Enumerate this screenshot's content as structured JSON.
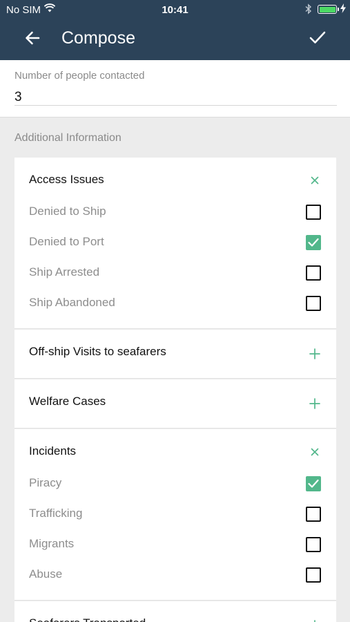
{
  "status_bar": {
    "carrier": "No SIM",
    "time": "10:41",
    "battery_level": 1.0,
    "charging": true
  },
  "app_bar": {
    "title": "Compose"
  },
  "people_contacted": {
    "label": "Number of people contacted",
    "value": "3"
  },
  "additional_info": {
    "heading": "Additional Information",
    "sections": [
      {
        "title": "Access Issues",
        "expanded": true,
        "options": [
          {
            "label": "Denied to Ship",
            "checked": false
          },
          {
            "label": "Denied to Port",
            "checked": true
          },
          {
            "label": "Ship Arrested",
            "checked": false
          },
          {
            "label": "Ship Abandoned",
            "checked": false
          }
        ]
      },
      {
        "title": "Off-ship Visits to seafarers",
        "expanded": false
      },
      {
        "title": "Welfare Cases",
        "expanded": false
      },
      {
        "title": "Incidents",
        "expanded": true,
        "options": [
          {
            "label": "Piracy",
            "checked": true
          },
          {
            "label": "Trafficking",
            "checked": false
          },
          {
            "label": "Migrants",
            "checked": false
          },
          {
            "label": "Abuse",
            "checked": false
          }
        ]
      },
      {
        "title": "Seafarers Transported",
        "expanded": false
      }
    ]
  },
  "colors": {
    "header_bg": "#2c4359",
    "accent": "#52b78b",
    "background": "#ececec"
  }
}
